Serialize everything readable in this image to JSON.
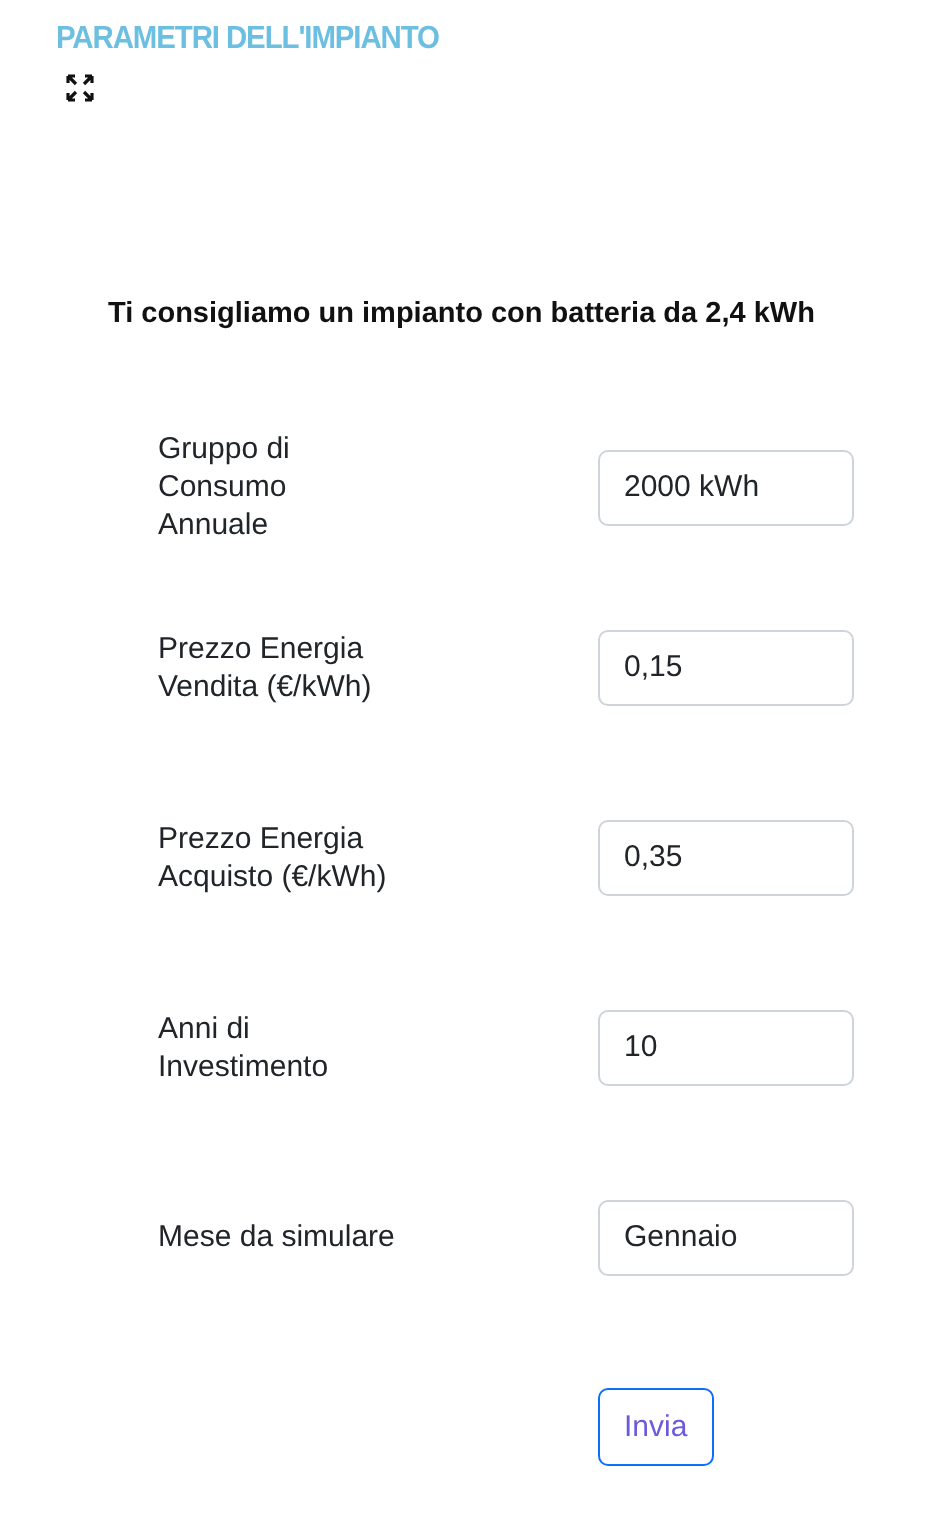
{
  "panel": {
    "title": "PARAMETRI DELL'IMPIANTO"
  },
  "recommendation": "Ti consigliamo un impianto con batteria da 2,4 kWh",
  "fields": [
    {
      "label_lines": [
        "Gruppo di",
        "Consumo",
        "Annuale"
      ],
      "value": "2000 kWh"
    },
    {
      "label_lines": [
        "Prezzo Energia",
        "Vendita (€/kWh)"
      ],
      "value": "0,15"
    },
    {
      "label_lines": [
        "Prezzo Energia",
        "Acquisto (€/kWh)"
      ],
      "value": "0,35"
    },
    {
      "label_lines": [
        "Anni di",
        "Investimento"
      ],
      "value": "10"
    },
    {
      "label_lines": [
        "Mese da simulare"
      ],
      "value": "Gennaio"
    }
  ],
  "submit_button": "Invia"
}
